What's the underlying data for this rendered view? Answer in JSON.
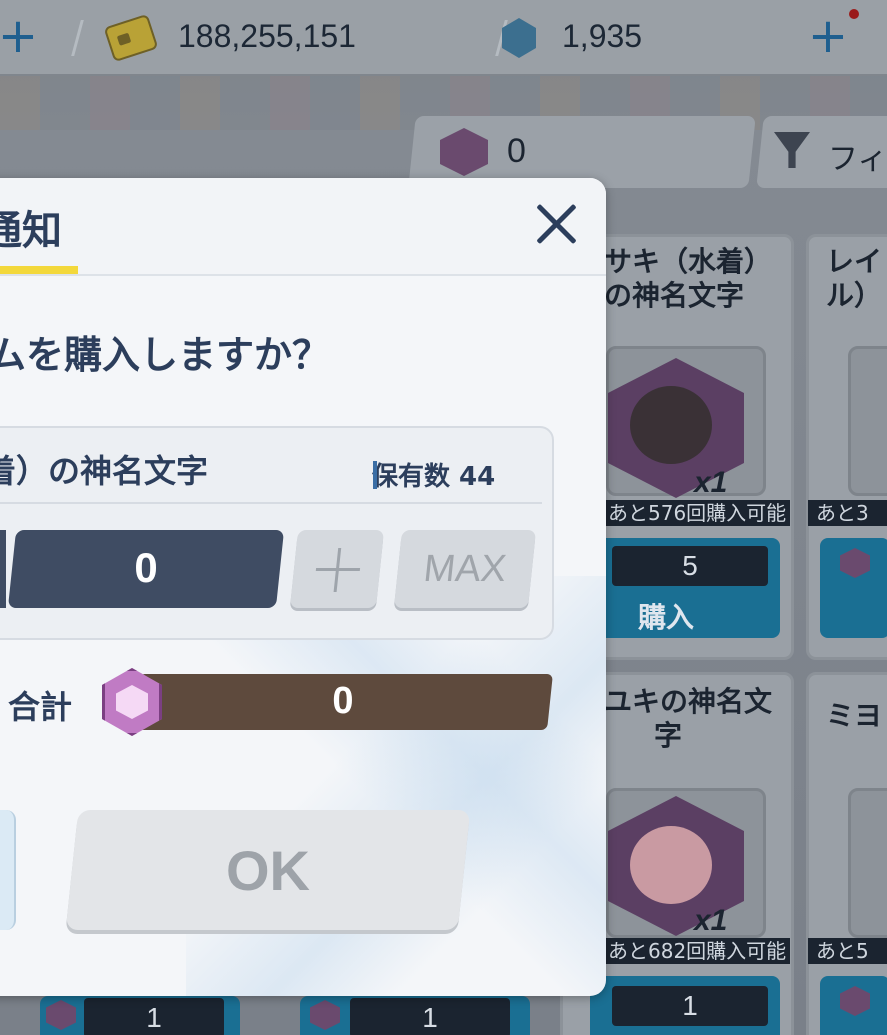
{
  "topbar": {
    "money": "188,255,151",
    "gems": "1,935"
  },
  "shop": {
    "currency_value": "0",
    "filter_label": "フィ",
    "cards": [
      {
        "name_line1": "サキ（水着）",
        "name_line2": "の神名文字",
        "qty": "x1",
        "remaining": "あと576回購入可能",
        "price": "5",
        "buy_label": "購入"
      },
      {
        "name_line1": "レイ",
        "name_line2": "ル）",
        "remaining": "あと3"
      },
      {
        "name_line1": "ユキの神名文",
        "name_line2": "字",
        "qty": "x1",
        "remaining": "あと682回購入可能",
        "price": "1"
      },
      {
        "name_line1": "ミヨ",
        "remaining": "あと5"
      }
    ],
    "bottom_prices": [
      "1",
      "1"
    ]
  },
  "modal": {
    "title": "通知",
    "question": "ムを購入しますか？",
    "item_name": "着）の神名文字",
    "owned_label": "保有数 44",
    "quantity": "0",
    "max_label": "MAX",
    "total_label": "合計",
    "total_value": "0",
    "ok_label": "OK"
  },
  "colors": {
    "accent_yellow": "#f3d83b",
    "title_navy": "#2c3e5c",
    "quantity_box": "#3f4c63",
    "total_bar": "#5e4a3d",
    "buy_blue": "#1a6f93"
  }
}
